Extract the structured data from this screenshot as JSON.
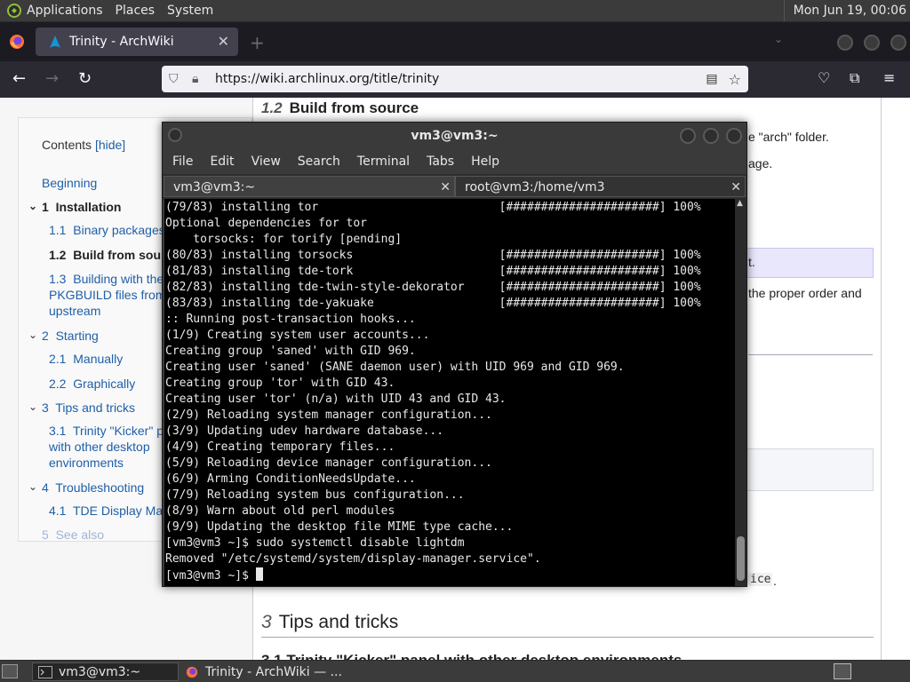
{
  "top_panel": {
    "menus": [
      "Applications",
      "Places",
      "System"
    ],
    "clock": "Mon Jun 19, 00:06"
  },
  "firefox": {
    "tab_title": "Trinity - ArchWiki",
    "url": "https://wiki.archlinux.org/title/trinity"
  },
  "wiki": {
    "toc_title": "Contents",
    "toc_hide": "[hide]",
    "toc": [
      {
        "text": "Beginning"
      },
      {
        "num": "1",
        "text": "Installation"
      },
      {
        "num": "1.1",
        "text": "Binary packages"
      },
      {
        "num": "1.2",
        "text": "Build from source"
      },
      {
        "num": "1.3",
        "text": "Building with the"
      },
      {
        "text": "PKGBUILD files from"
      },
      {
        "text": "upstream"
      },
      {
        "num": "2",
        "text": "Starting"
      },
      {
        "num": "2.1",
        "text": "Manually"
      },
      {
        "num": "2.2",
        "text": "Graphically"
      },
      {
        "num": "3",
        "text": "Tips and tricks"
      },
      {
        "num": "3.1",
        "text": "Trinity \"Kicker\" p"
      },
      {
        "text": "with other desktop"
      },
      {
        "text": "environments"
      },
      {
        "num": "4",
        "text": "Troubleshooting"
      },
      {
        "num": "4.1",
        "text": "TDE Display Ma"
      },
      {
        "num": "5",
        "text": "See also"
      }
    ],
    "section_12_num": "1.2",
    "section_12_title": "Build from source",
    "frag_arch": "e \"arch\" folder.",
    "frag_age": "age.",
    "frag_t": "t.",
    "frag_proper": "the proper order and",
    "frag_ice": "ice",
    "frag_dot": ".",
    "section_3_num": "3",
    "section_3_title": "Tips and tricks",
    "section_31_partial": "3.1 Trinity \"Kicker\" panel with other desktop environments"
  },
  "terminal": {
    "title": "vm3@vm3:~",
    "menus": [
      "File",
      "Edit",
      "View",
      "Search",
      "Terminal",
      "Tabs",
      "Help"
    ],
    "tabs": [
      "vm3@vm3:~",
      "root@vm3:/home/vm3"
    ],
    "lines": [
      "(79/83) installing tor                          [######################] 100%",
      "Optional dependencies for tor",
      "    torsocks: for torify [pending]",
      "(80/83) installing torsocks                     [######################] 100%",
      "(81/83) installing tde-tork                     [######################] 100%",
      "(82/83) installing tde-twin-style-dekorator     [######################] 100%",
      "(83/83) installing tde-yakuake                  [######################] 100%",
      ":: Running post-transaction hooks...",
      "(1/9) Creating system user accounts...",
      "Creating group 'saned' with GID 969.",
      "Creating user 'saned' (SANE daemon user) with UID 969 and GID 969.",
      "Creating group 'tor' with GID 43.",
      "Creating user 'tor' (n/a) with UID 43 and GID 43.",
      "(2/9) Reloading system manager configuration...",
      "(3/9) Updating udev hardware database...",
      "(4/9) Creating temporary files...",
      "(5/9) Reloading device manager configuration...",
      "(6/9) Arming ConditionNeedsUpdate...",
      "(7/9) Reloading system bus configuration...",
      "(8/9) Warn about old perl modules",
      "(9/9) Updating the desktop file MIME type cache...",
      "[vm3@vm3 ~]$ sudo systemctl disable lightdm",
      "Removed \"/etc/systemd/system/display-manager.service\"."
    ],
    "prompt": "[vm3@vm3 ~]$ "
  },
  "taskbar": {
    "items": [
      "vm3@vm3:~",
      "Trinity - ArchWiki — ..."
    ]
  }
}
